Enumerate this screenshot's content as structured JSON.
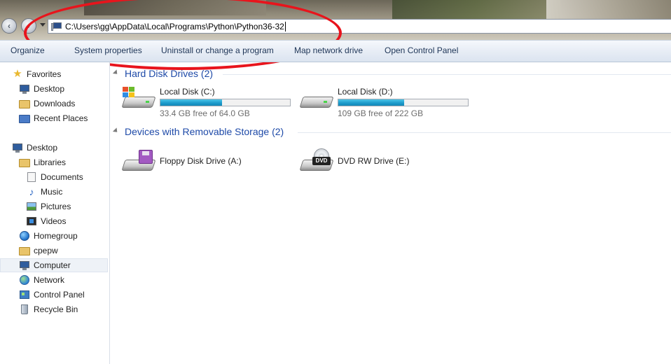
{
  "address": {
    "path": "C:\\Users\\gg\\AppData\\Local\\Programs\\Python\\Python36-32"
  },
  "toolbar": {
    "organize": "Organize",
    "system_properties": "System properties",
    "uninstall": "Uninstall or change a program",
    "map_network_drive": "Map network drive",
    "open_control_panel": "Open Control Panel"
  },
  "sidebar": {
    "favorites": "Favorites",
    "desktop_fav": "Desktop",
    "downloads": "Downloads",
    "recent_places": "Recent Places",
    "desktop": "Desktop",
    "libraries": "Libraries",
    "documents": "Documents",
    "music": "Music",
    "pictures": "Pictures",
    "videos": "Videos",
    "homegroup": "Homegroup",
    "cpepw": "cpepw",
    "computer": "Computer",
    "network": "Network",
    "control_panel": "Control Panel",
    "recycle_bin": "Recycle Bin"
  },
  "groups": {
    "hard_disk": "Hard Disk Drives (2)",
    "removable": "Devices with Removable Storage (2)"
  },
  "drives": {
    "c": {
      "name": "Local Disk (C:)",
      "free": "33.4 GB free of 64.0 GB",
      "used_fraction": 0.478
    },
    "d": {
      "name": "Local Disk (D:)",
      "free": "109 GB free of 222 GB",
      "used_fraction": 0.509
    },
    "a": {
      "name": "Floppy Disk Drive (A:)"
    },
    "e": {
      "name": "DVD RW Drive (E:)",
      "icon_label": "DVD"
    }
  },
  "colors": {
    "annotation_circle": "#e8141c",
    "capacity_bar": "#1e9ccc",
    "group_header": "#1e4aa8"
  }
}
